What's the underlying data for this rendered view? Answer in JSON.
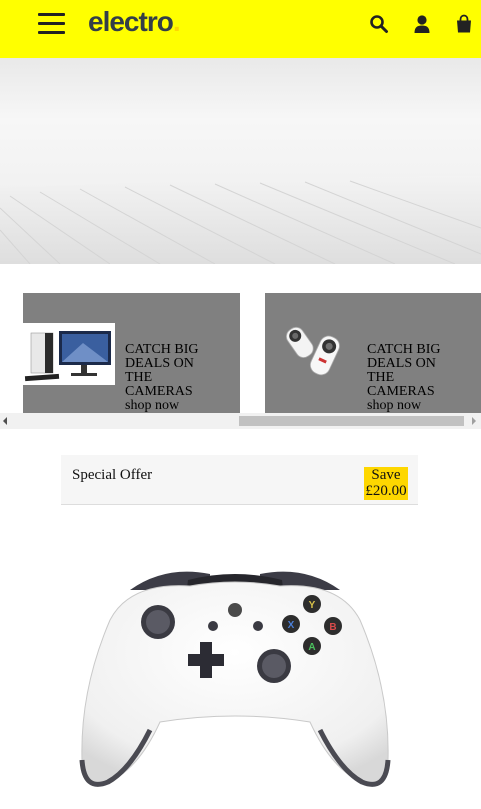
{
  "header": {
    "logo_text": "electro",
    "logo_dot": ".",
    "colors": {
      "bar": "#ffff00",
      "logo_text": "#333e48",
      "logo_dot": "#fed700"
    },
    "icons": [
      "menu-icon",
      "search-icon",
      "user-icon",
      "shopping-bag-icon"
    ]
  },
  "carousel": {
    "items": [
      {
        "title": "CATCH BIG\nDEALS ON\nTHE\n CAMERAS",
        "cta": "shop now",
        "image": "desktop-computer"
      },
      {
        "title": "CATCH BIG\nDEALS ON\nTHE\n CAMERAS",
        "cta": "shop now",
        "image": "360-camera"
      }
    ],
    "scroll_position": 0.5
  },
  "special_offer": {
    "title": "Special Offer",
    "badge_line1": "Save",
    "badge_line2": "£20.00",
    "badge_color": "#fed700"
  },
  "product": {
    "image": "white-game-controller"
  }
}
